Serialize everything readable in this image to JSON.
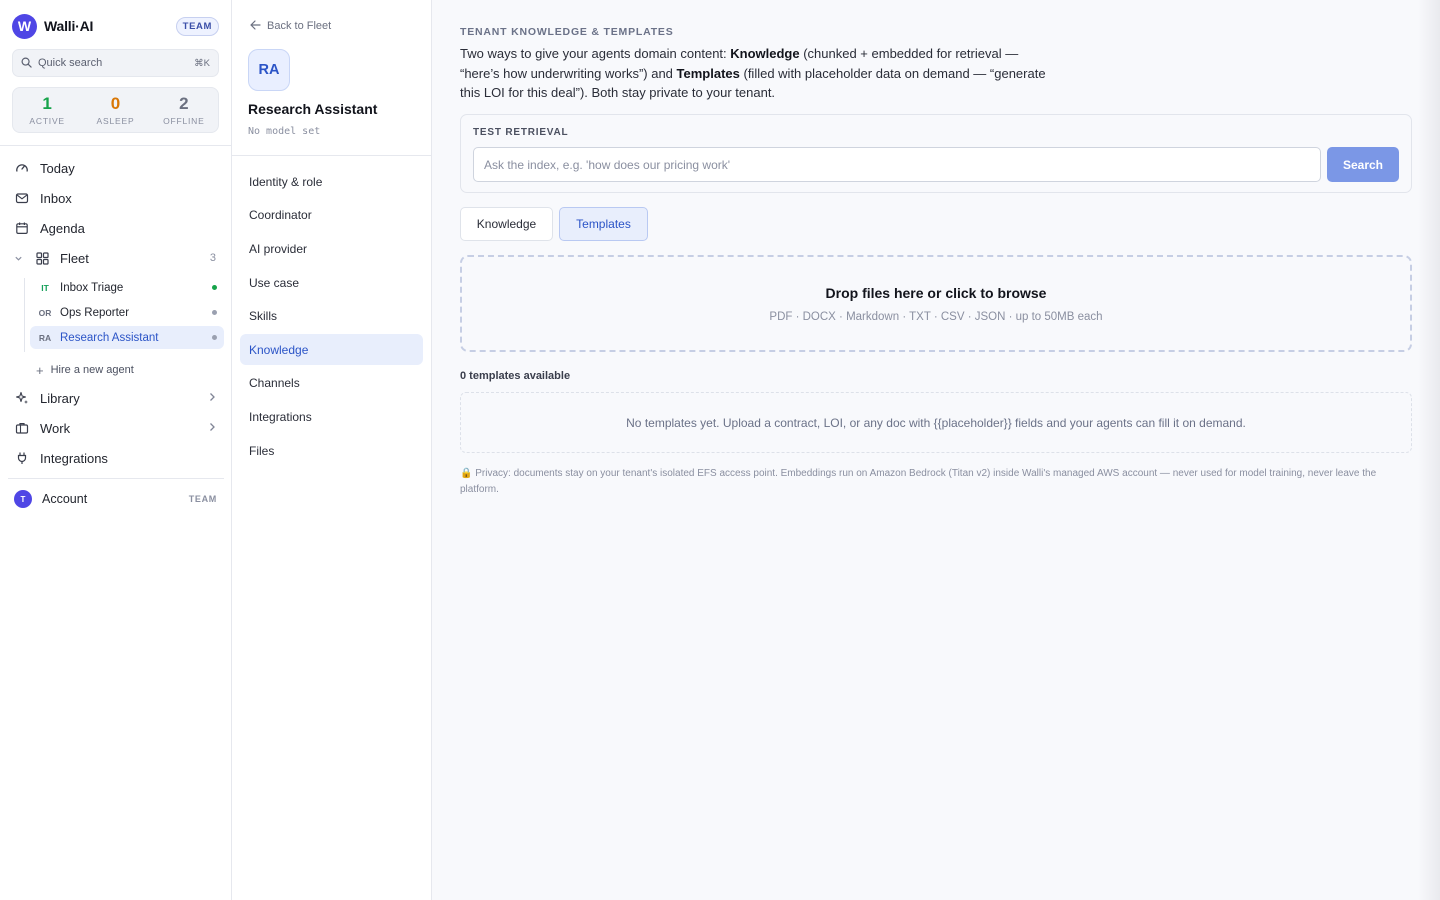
{
  "app": {
    "name": "Walli·AI",
    "logo_letter": "W",
    "plan_badge": "TEAM"
  },
  "sidebar": {
    "search_label": "Quick search",
    "search_shortcut": "⌘K",
    "stats": [
      {
        "value": "1",
        "label": "ACTIVE",
        "color": "#16a34a"
      },
      {
        "value": "0",
        "label": "ASLEEP",
        "color": "#d97706"
      },
      {
        "value": "2",
        "label": "OFFLINE",
        "color": "#6b7080"
      }
    ],
    "nav": {
      "today": "Today",
      "inbox": "Inbox",
      "agenda": "Agenda",
      "fleet": "Fleet",
      "fleet_count": "3",
      "library": "Library",
      "work": "Work",
      "integrations": "Integrations"
    },
    "agents": [
      {
        "initials": "IT",
        "name": "Inbox Triage",
        "status": "online"
      },
      {
        "initials": "OR",
        "name": "Ops Reporter",
        "status": "offline"
      },
      {
        "initials": "RA",
        "name": "Research Assistant",
        "status": "offline"
      }
    ],
    "hire_label": "Hire a new agent",
    "account": {
      "initial": "T",
      "label": "Account",
      "tag": "TEAM"
    }
  },
  "agent_panel": {
    "back_label": "Back to Fleet",
    "initials": "RA",
    "name": "Research Assistant",
    "model": "No model set",
    "menu": [
      "Identity & role",
      "Coordinator",
      "AI provider",
      "Use case",
      "Skills",
      "Knowledge",
      "Channels",
      "Integrations",
      "Files"
    ],
    "active_menu": "Knowledge"
  },
  "main": {
    "section_title": "TENANT KNOWLEDGE & TEMPLATES",
    "intro": {
      "part1": "Two ways to give your agents domain content: ",
      "knowledge": "Knowledge",
      "part2": " (chunked + embedded for retrieval — “here’s how underwriting works”) and ",
      "templates": "Templates",
      "part3": " (filled with placeholder data on demand — “generate this LOI for this deal”). Both stay private to your tenant."
    },
    "retrieval": {
      "label": "TEST RETRIEVAL",
      "placeholder": "Ask the index, e.g. 'how does our pricing work'",
      "value": "",
      "button": "Search"
    },
    "tabs": {
      "knowledge": "Knowledge",
      "templates": "Templates",
      "active": "Templates"
    },
    "dropzone": {
      "title": "Drop files here or click to browse",
      "subtitle": "PDF · DOCX · Markdown · TXT · CSV · JSON · up to 50MB each"
    },
    "templates_count": "0 templates available",
    "empty_message": "No templates yet. Upload a contract, LOI, or any doc with {{placeholder}} fields and your agents can fill it on demand.",
    "privacy": "🔒 Privacy: documents stay on your tenant's isolated EFS access point. Embeddings run on Amazon Bedrock (Titan v2) inside Walli's managed AWS account — never used for model training, never leave the platform."
  },
  "colors": {
    "accent": "#2b54c7",
    "brand": "#4f46e5",
    "search_button": "#7b97e6",
    "active_bg": "#e8eefc"
  }
}
